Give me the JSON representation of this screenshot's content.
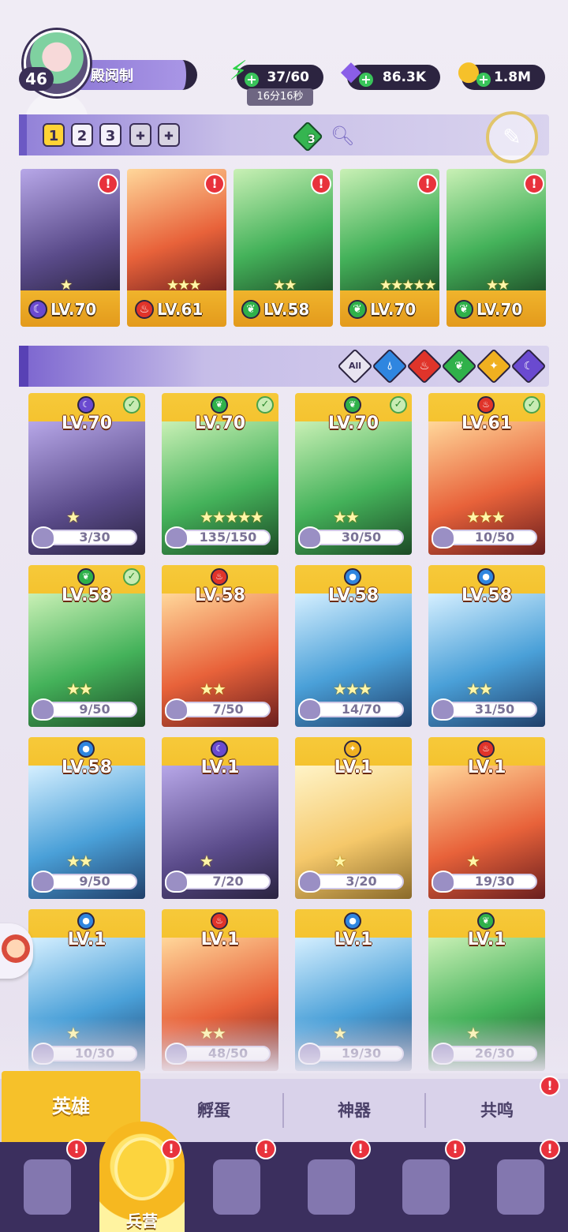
{
  "player": {
    "level": "46",
    "name": "殿阅制"
  },
  "resources": {
    "energy": {
      "value": "37/60",
      "timer": "16分16秒",
      "icon": "lightning-icon"
    },
    "gems": {
      "value": "86.3K",
      "icon": "diamond-icon"
    },
    "gold": {
      "value": "1.8M",
      "icon": "coin-icon"
    }
  },
  "team_bar": {
    "tabs": [
      "1",
      "2",
      "3"
    ],
    "active_tab": "1",
    "gem_count": "3"
  },
  "team_slots": [
    {
      "level": "LV.70",
      "element": "dark",
      "stars": "★",
      "color": "#6a5ad0"
    },
    {
      "level": "LV.61",
      "element": "fire",
      "stars": "★★★",
      "color": "#e24a2a"
    },
    {
      "level": "LV.58",
      "element": "nature",
      "stars": "★★",
      "color": "#35b550"
    },
    {
      "level": "LV.70",
      "element": "nature",
      "stars": "★★★★★",
      "color": "#35b550"
    },
    {
      "level": "LV.70",
      "element": "nature",
      "stars": "★★",
      "color": "#35b550"
    }
  ],
  "filters": [
    {
      "name": "all",
      "label": "All"
    },
    {
      "name": "water",
      "color": "#2f86e0"
    },
    {
      "name": "fire",
      "color": "#e0342a"
    },
    {
      "name": "nature",
      "color": "#2fb14a"
    },
    {
      "name": "light",
      "color": "#f0b020"
    },
    {
      "name": "dark",
      "color": "#6a4ad0"
    }
  ],
  "heroes": [
    {
      "level": "LV.70",
      "element": "dark",
      "shards": "3/30",
      "stars": "★",
      "selected": true
    },
    {
      "level": "LV.70",
      "element": "nature",
      "shards": "135/150",
      "stars": "★★★★★",
      "selected": true
    },
    {
      "level": "LV.70",
      "element": "nature",
      "shards": "30/50",
      "stars": "★★",
      "selected": true
    },
    {
      "level": "LV.61",
      "element": "fire",
      "shards": "10/50",
      "stars": "★★★",
      "selected": true
    },
    {
      "level": "LV.58",
      "element": "nature",
      "shards": "9/50",
      "stars": "★★",
      "selected": true
    },
    {
      "level": "LV.58",
      "element": "fire",
      "shards": "7/50",
      "stars": "★★",
      "selected": false
    },
    {
      "level": "LV.58",
      "element": "water",
      "shards": "14/70",
      "stars": "★★★",
      "selected": false
    },
    {
      "level": "LV.58",
      "element": "water",
      "shards": "31/50",
      "stars": "★★",
      "selected": false
    },
    {
      "level": "LV.58",
      "element": "water",
      "shards": "9/50",
      "stars": "★★",
      "selected": false
    },
    {
      "level": "LV.1",
      "element": "dark",
      "shards": "7/20",
      "stars": "★",
      "selected": false
    },
    {
      "level": "LV.1",
      "element": "light",
      "shards": "3/20",
      "stars": "★",
      "selected": false
    },
    {
      "level": "LV.1",
      "element": "fire",
      "shards": "19/30",
      "stars": "★",
      "selected": false
    },
    {
      "level": "LV.1",
      "element": "water",
      "shards": "10/30",
      "stars": "★",
      "selected": false
    },
    {
      "level": "LV.1",
      "element": "fire",
      "shards": "48/50",
      "stars": "★★",
      "selected": false
    },
    {
      "level": "LV.1",
      "element": "water",
      "shards": "19/30",
      "stars": "★",
      "selected": false
    },
    {
      "level": "LV.1",
      "element": "nature",
      "shards": "26/30",
      "stars": "★",
      "selected": false
    }
  ],
  "sub_tabs": [
    "英雄",
    "孵蛋",
    "神器",
    "共鸣"
  ],
  "bottom_nav": [
    {
      "name": "cards",
      "label": ""
    },
    {
      "name": "barracks",
      "label": "兵营"
    },
    {
      "name": "map",
      "label": ""
    },
    {
      "name": "castle",
      "label": ""
    },
    {
      "name": "guild",
      "label": ""
    },
    {
      "name": "banner",
      "label": ""
    }
  ],
  "colors": {
    "dark": "#6a4ad0",
    "fire": "#e0342a",
    "nature": "#2fb14a",
    "water": "#2f86e0",
    "light": "#f0b020",
    "accent": "#f6c12a",
    "nav_bg": "#3b2f5e"
  }
}
